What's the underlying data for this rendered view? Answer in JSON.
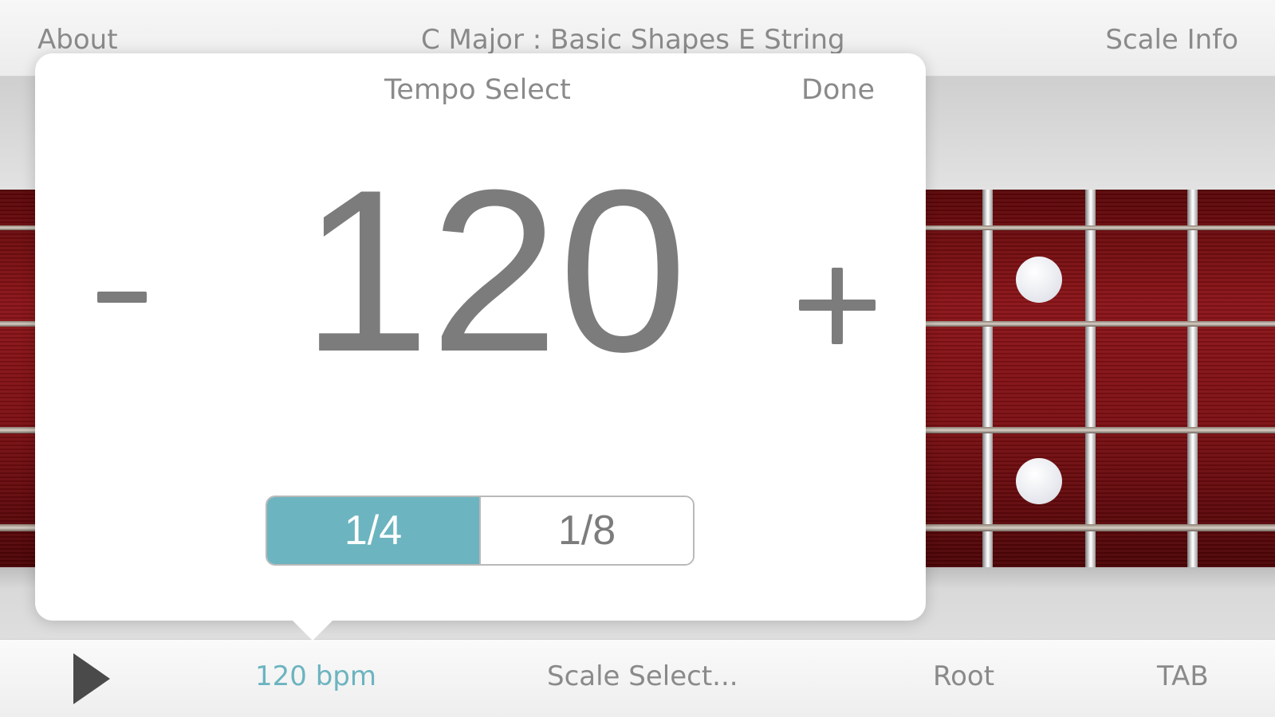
{
  "nav": {
    "about": "About",
    "title": "C Major : Basic Shapes E String",
    "scale_info": "Scale Info"
  },
  "popover": {
    "title": "Tempo Select",
    "done": "Done",
    "tempo": "120",
    "minus": "-",
    "plus": "+",
    "segments": [
      "1/4",
      "1/8"
    ],
    "selected_segment": "1/4"
  },
  "toolbar": {
    "play": "play-icon",
    "bpm": "120 bpm",
    "scale_select": "Scale Select...",
    "root": "Root",
    "tab": "TAB"
  },
  "colors": {
    "accent": "#6cb4c0",
    "text_gray": "#8a8a8a",
    "fretboard": "#7e1014"
  }
}
